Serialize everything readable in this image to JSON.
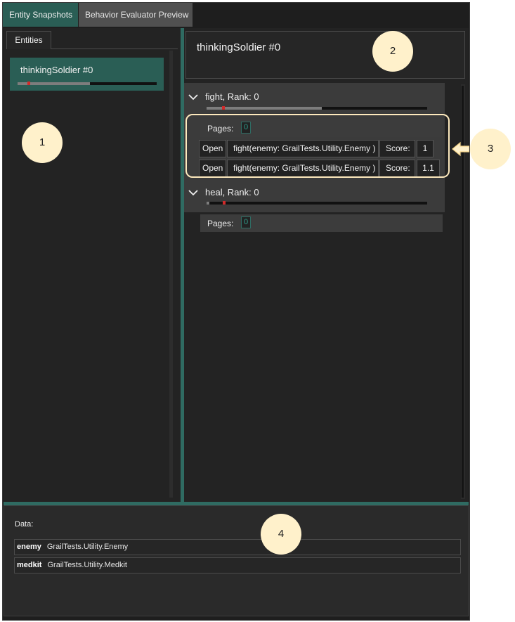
{
  "tabs": [
    {
      "label": "Entity Snapshots",
      "active": true
    },
    {
      "label": "Behavior Evaluator Preview",
      "active": false
    }
  ],
  "entities_panel": {
    "tab_label": "Entities",
    "items": [
      {
        "label": "thinkingSoldier #0",
        "selected": true,
        "progress": 0.52
      }
    ]
  },
  "header": {
    "title": "thinkingSoldier #0"
  },
  "actions": [
    {
      "label": "fight, Rank: 0",
      "expanded": true,
      "progress": 0.52,
      "pages_label": "Pages:",
      "pages_value": "0",
      "rows": [
        {
          "open_label": "Open",
          "name": "fight(enemy: GrailTests.Utility.Enemy )",
          "score_label": "Score:",
          "score": "1"
        },
        {
          "open_label": "Open",
          "name": "fight(enemy: GrailTests.Utility.Enemy )",
          "score_label": "Score:",
          "score": "1.1"
        }
      ]
    },
    {
      "label": "heal, Rank: 0",
      "expanded": true,
      "progress": 0.01,
      "pages_label": "Pages:",
      "pages_value": "0",
      "rows": []
    }
  ],
  "data_panel": {
    "label": "Data:",
    "rows": [
      {
        "key": "enemy",
        "value": "GrailTests.Utility.Enemy"
      },
      {
        "key": "medkit",
        "value": "GrailTests.Utility.Medkit"
      }
    ]
  },
  "callouts": [
    "1",
    "2",
    "3",
    "4"
  ],
  "icons": {
    "collapse": "chevron-down-icon",
    "pointer": "left-arrow-icon"
  },
  "colors": {
    "accent": "#2a5e55",
    "splitter": "#2f6b62",
    "callout": "#fff1cb",
    "marker": "#d22a2a"
  }
}
